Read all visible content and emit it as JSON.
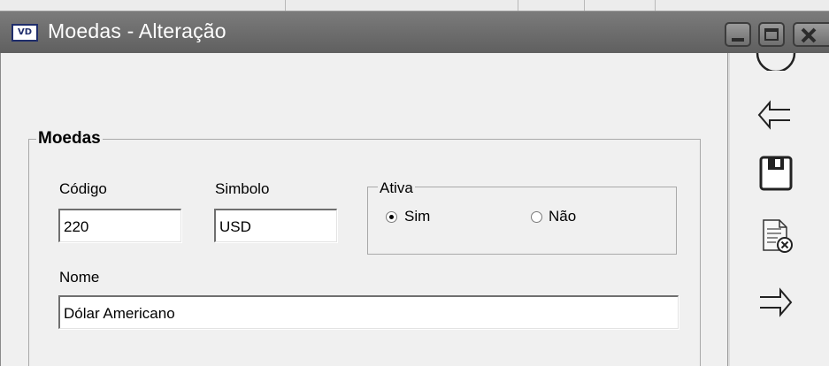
{
  "window": {
    "title": "Moedas - Alteração",
    "app_icon_text": "VD"
  },
  "form": {
    "group_title": "Moedas",
    "codigo": {
      "label": "Código",
      "value": "220"
    },
    "simbolo": {
      "label": "Simbolo",
      "value": "USD"
    },
    "ativa": {
      "label": "Ativa",
      "options": [
        {
          "label": "Sim",
          "selected": true
        },
        {
          "label": "Não",
          "selected": false
        }
      ]
    },
    "nome": {
      "label": "Nome",
      "value": "Dólar Americano"
    }
  },
  "toolbar": {
    "buttons": [
      "back-arrow-icon",
      "save-icon",
      "cancel-document-icon",
      "forward-arrow-icon"
    ]
  },
  "colors": {
    "titlebar": "#6b6b6b",
    "title_text": "#ffffff",
    "background": "#f0f0f0"
  }
}
